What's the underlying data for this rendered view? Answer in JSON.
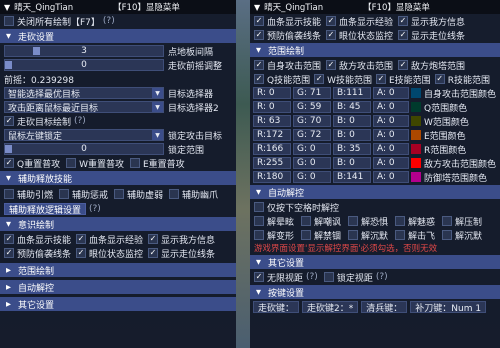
{
  "left": {
    "title": "晴天_QingTian",
    "hotkey": "【F10】显隐菜单",
    "close_all": "关闭所有绘制【F7】",
    "help": "(?)",
    "sec_aim": "走砍设置",
    "slider1_val": "3",
    "slider1_label": "点地板间隔",
    "slider1_fill": 0.18,
    "slider2_val": "0",
    "slider2_label": "走砍前摇调整",
    "slider2_fill": 0.0,
    "latency": "前摇：0.239298",
    "sel1": "智能选择最优目标",
    "sel1_label": "目标选择器",
    "sel2": "攻击距离鼠标最近目标",
    "sel2_label": "目标选择器2",
    "aim_draw": "走砍目标绘制",
    "lock": "鼠标左键锁定",
    "lock_label": "锁定攻击目标",
    "range_val": "0",
    "range_label": "锁定范围",
    "range_fill": 0.0,
    "q_reset": "Q重置普攻",
    "w_reset": "W重置普攻",
    "e_reset": "E重置普攻",
    "sec_aux": "辅助释放技能",
    "aux1": "辅助引燃",
    "aux2": "辅助惩戒",
    "aux3": "辅助虚弱",
    "aux4": "辅助幽爪",
    "aux_btn": "辅助释放逻辑设置",
    "sec_aware": "意识绘制",
    "aw1": "血条显示技能",
    "aw2": "血条显示经验",
    "aw3": "显示我方信息",
    "aw4": "预防偷袭线条",
    "aw5": "眼位状态监控",
    "aw6": "显示走位线条",
    "sec_range": "范围绘制",
    "sec_auto": "自动解控",
    "sec_other": "其它设置"
  },
  "right": {
    "title": "晴天_QingTian",
    "hotkey": "【F10】显隐菜单",
    "t1": "血条显示技能",
    "t2": "血条显示经验",
    "t3": "显示我方信息",
    "t4": "预防偷袭线条",
    "t5": "眼位状态监控",
    "t6": "显示走位线条",
    "sec_range": "范围绘制",
    "r1": "自身攻击范围",
    "r2": "敌方攻击范围",
    "r3": "敌方炮塔范围",
    "r4": "Q技能范围",
    "r5": "W技能范围",
    "r6": "E技能范围",
    "r7": "R技能范围",
    "colors": [
      {
        "r": "R:  0",
        "g": "G: 71",
        "b": "B:111",
        "a": "A:  0",
        "label": "自身攻击范围颜色",
        "hex": "#00476f"
      },
      {
        "r": "R:  0",
        "g": "G: 59",
        "b": "B: 45",
        "a": "A:  0",
        "label": "Q范围颜色",
        "hex": "#003b2d"
      },
      {
        "r": "R: 63",
        "g": "G: 70",
        "b": "B:  0",
        "a": "A:  0",
        "label": "W范围颜色",
        "hex": "#3f4600"
      },
      {
        "r": "R:172",
        "g": "G: 72",
        "b": "B:  0",
        "a": "A:  0",
        "label": "E范围颜色",
        "hex": "#ac4800"
      },
      {
        "r": "R:166",
        "g": "G:  0",
        "b": "B: 35",
        "a": "A:  0",
        "label": "R范围颜色",
        "hex": "#a60023"
      },
      {
        "r": "R:255",
        "g": "G:  0",
        "b": "B:  0",
        "a": "A:  0",
        "label": "敌方攻击范围颜色",
        "hex": "#ff0000"
      },
      {
        "r": "R:180",
        "g": "G:  0",
        "b": "B:141",
        "a": "A:  0",
        "label": "防御塔范围颜色",
        "hex": "#b4008d"
      }
    ],
    "sec_auto": "自动解控",
    "a0": "仅按下空格时解控",
    "a1": "解晕眩",
    "a2": "解嘲讽",
    "a3": "解恐惧",
    "a4": "解魅惑",
    "a5": "解压制",
    "a6": "解变形",
    "a7": "解禁锢",
    "a8": "解沉默",
    "a9": "解击飞",
    "a10": "解沉默",
    "warning": "游戏界面设置'显示解控界面'必须勾选，否则无效",
    "sec_other": "其它设置",
    "o1": "无限视距",
    "o2": "锁定视距",
    "sec_key": "按键设置",
    "k1": "走砍键：",
    "k2": "走砍键2：*",
    "k3": "清兵键：",
    "k4": "补刀键：Num 1",
    "help": "(?)"
  }
}
